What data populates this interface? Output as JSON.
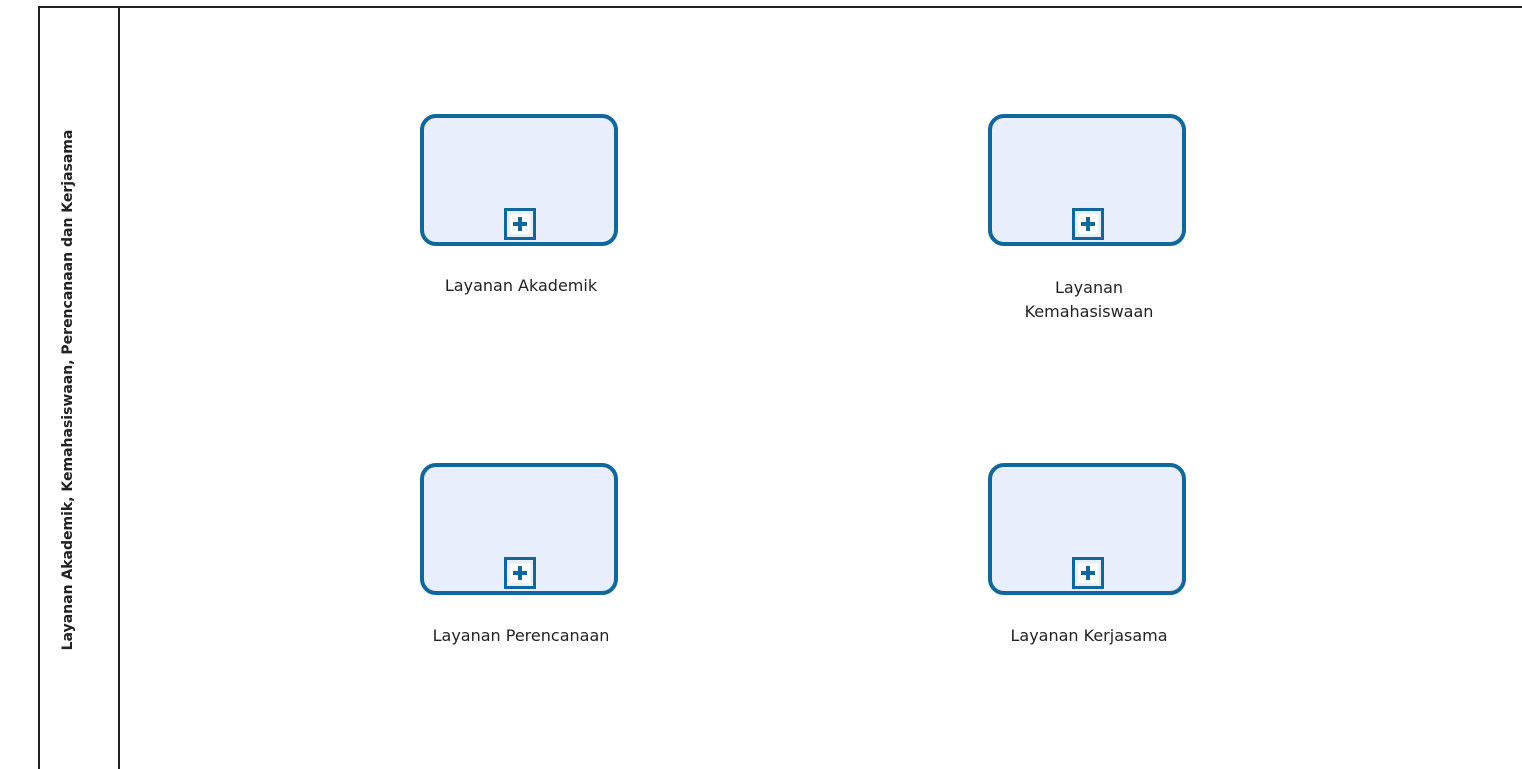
{
  "lane": {
    "title": "Layanan Akademik, Kemahasiswaan, Perencanaan dan Kerjasama"
  },
  "subprocesses": [
    {
      "label_line1": "Layanan Akademik",
      "label_line2": ""
    },
    {
      "label_line1": "Layanan",
      "label_line2": "Kemahasiswaan"
    },
    {
      "label_line1": "Layanan Perencanaan",
      "label_line2": ""
    },
    {
      "label_line1": "Layanan Kerjasama",
      "label_line2": ""
    }
  ],
  "colors": {
    "task_stroke": "#10679c",
    "task_fill": "#e8eefc",
    "lane_border": "#222222"
  },
  "icons": {
    "collapsed_marker": "plus-icon"
  }
}
